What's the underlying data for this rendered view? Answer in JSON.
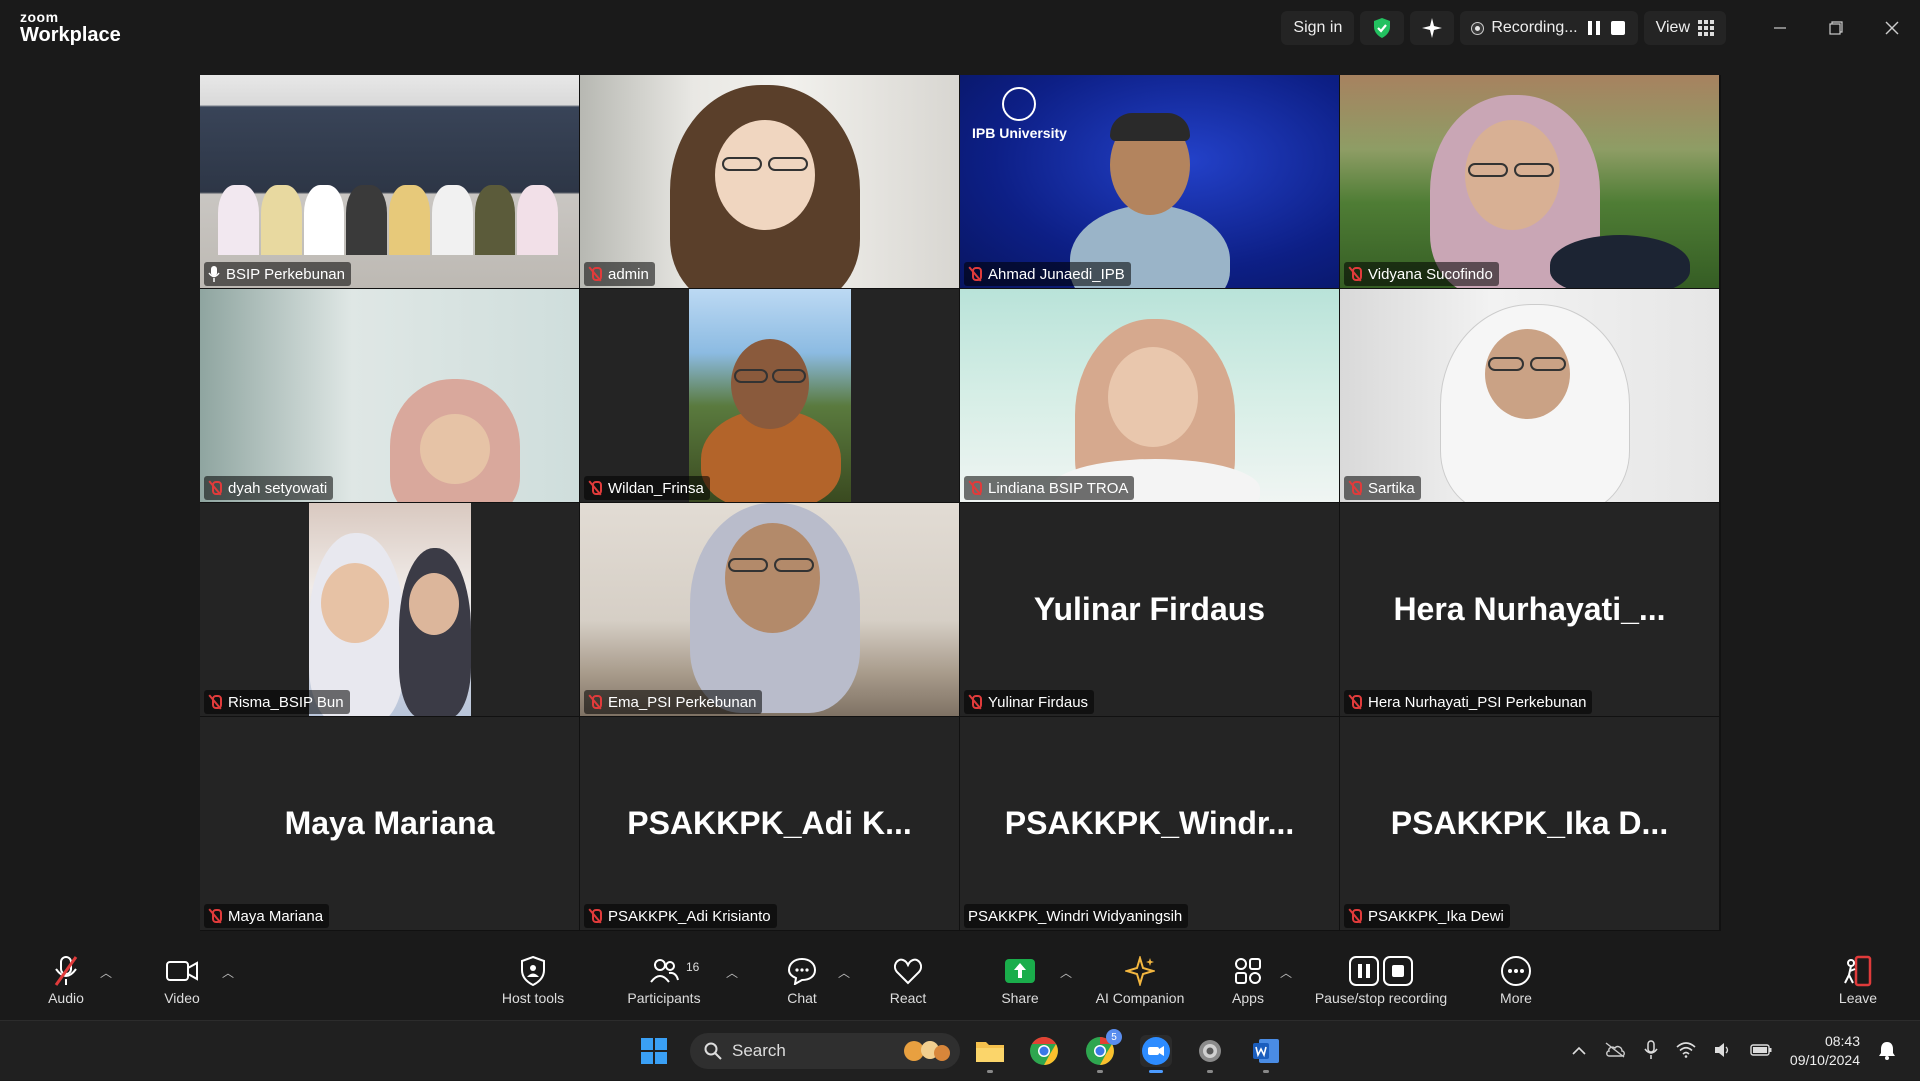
{
  "app": {
    "logo_top": "zoom",
    "logo_bottom": "Workplace",
    "sign_in": "Sign in",
    "recording_text": "Recording...",
    "view_label": "View"
  },
  "tiles": [
    {
      "name": "BSIP Perkebunan",
      "mic": "active"
    },
    {
      "name": "admin",
      "mic": "muted"
    },
    {
      "name": "Ahmad Junaedi_IPB",
      "mic": "muted"
    },
    {
      "name": "Vidyana Sucofindo",
      "mic": "muted"
    },
    {
      "name": "dyah setyowati",
      "mic": "muted"
    },
    {
      "name": "Wildan_Frinsa",
      "mic": "muted"
    },
    {
      "name": "Lindiana BSIP TROA",
      "mic": "muted"
    },
    {
      "name": "Sartika",
      "mic": "muted"
    },
    {
      "name": "Risma_BSIP Bun",
      "mic": "muted"
    },
    {
      "name": "Ema_PSI Perkebunan",
      "mic": "muted"
    },
    {
      "name": "Yulinar Firdaus",
      "display": "Yulinar Firdaus",
      "mic": "muted"
    },
    {
      "name": "Hera Nurhayati_PSI Perkebunan",
      "display": "Hera  Nurhayati_...",
      "mic": "muted"
    },
    {
      "name": "Maya Mariana",
      "display": "Maya Mariana",
      "mic": "muted"
    },
    {
      "name": "PSAKKPK_Adi Krisianto",
      "display": "PSAKKPK_Adi  K...",
      "mic": "muted"
    },
    {
      "name": "PSAKKPK_Windri Widyaningsih",
      "display": "PSAKKPK_Windr...",
      "mic": "none"
    },
    {
      "name": "PSAKKPK_Ika Dewi",
      "display": "PSAKKPK_Ika  D...",
      "mic": "muted"
    }
  ],
  "ipb_text": "IPB University",
  "toolbar": {
    "audio": "Audio",
    "video": "Video",
    "host_tools": "Host tools",
    "participants": "Participants",
    "participants_count": "16",
    "chat": "Chat",
    "react": "React",
    "share": "Share",
    "ai_companion": "AI Companion",
    "apps": "Apps",
    "pause_recording": "Pause/stop recording",
    "more": "More",
    "leave": "Leave"
  },
  "taskbar": {
    "search_placeholder": "Search",
    "time": "08:43",
    "date": "09/10/2024",
    "chrome_badge": "5"
  },
  "colors": {
    "active_speaker": "#23d160",
    "muted_mic": "#e03b3b",
    "share_green": "#1aad4b",
    "leave_red": "#e03b3b"
  }
}
